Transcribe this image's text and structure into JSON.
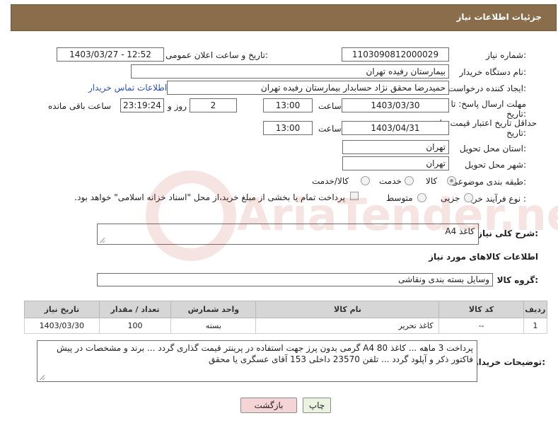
{
  "header": {
    "title": "جزئیات اطلاعات نیاز"
  },
  "fields": {
    "need_number": {
      "label": "شماره نیاز:",
      "value": "1103090812000029"
    },
    "announce_datetime": {
      "label": "تاریخ و ساعت اعلان عمومی:",
      "value": "1403/03/27 - 12:52"
    },
    "buyer_org": {
      "label": "نام دستگاه خریدار:",
      "value": "بیمارستان رفیده تهران"
    },
    "requester": {
      "label": "ایجاد کننده درخواست:",
      "value": "حمیدرضا  محقق نژاد حسابدار بیمارستان رفیده تهران",
      "contact_link": "اطلاعات تماس خریدار"
    },
    "response_deadline": {
      "label_line1": "مهلت ارسال پاسخ: تا",
      "label_line2": "تاریخ:",
      "date": "1403/03/30",
      "time_label": "ساعت",
      "time": "13:00",
      "days": "2",
      "days_label": "روز و",
      "remaining": "23:19:24",
      "remaining_label": "ساعت باقی مانده"
    },
    "price_validity": {
      "label_line1": "حداقل تاریخ اعتبار قیمت: تا",
      "label_line2": "تاریخ:",
      "date": "1403/04/31",
      "time_label": "ساعت",
      "time": "13:00"
    },
    "delivery_province": {
      "label": "استان محل تحویل:",
      "value": "تهران"
    },
    "delivery_city": {
      "label": "شهر محل تحویل:",
      "value": "تهران"
    },
    "category": {
      "label": "طبقه بندی موضوعی:",
      "options": [
        "کالا",
        "خدمت",
        "کالا/خدمت"
      ],
      "selected": "کالا"
    },
    "purchase_process": {
      "label": "نوع فرآیند خرید :",
      "options": [
        "جزیی",
        "متوسط"
      ],
      "checkbox_text": "پرداخت تمام یا بخشی از مبلغ خرید،از محل \"اسناد خزانه اسلامی\" خواهد بود."
    }
  },
  "description": {
    "label": "شرح کلی نیاز:",
    "value": "کاغذ A4"
  },
  "goods_section": {
    "title": "اطلاعات کالاهای مورد نیاز"
  },
  "goods_group": {
    "label": "گروه کالا:",
    "value": "وسایل بسته بندی  ونقاشی"
  },
  "table": {
    "headers": [
      "ردیف",
      "کد کالا",
      "نام کالا",
      "واحد شمارش",
      "تعداد / مقدار",
      "تاریخ نیاز"
    ],
    "rows": [
      [
        "1",
        "--",
        "کاغذ تحریر",
        "بسته",
        "100",
        "1403/03/30"
      ]
    ]
  },
  "buyer_notes": {
    "label": "توضیحات خریدار:",
    "value": "پرداخت 3 ماهه ... کاغذ A4 80 گرمی بدون پرز جهت استفاده در پرینتر قیمت گذاری گردد ... برند و مشخصات در پیش فاکتور ذکر و آپلود گردد ... تلفن 23570 داخلی 153 آقای عسگری یا محقق"
  },
  "buttons": {
    "print": "چاپ",
    "back": "بازگشت"
  },
  "watermark": {
    "text": "AriaTender.neT"
  },
  "colors": {
    "header_bg": "#8a6e4b",
    "link": "#2b4fb3",
    "back_btn": "#f4d4d4",
    "print_btn": "#eaf3e0"
  }
}
